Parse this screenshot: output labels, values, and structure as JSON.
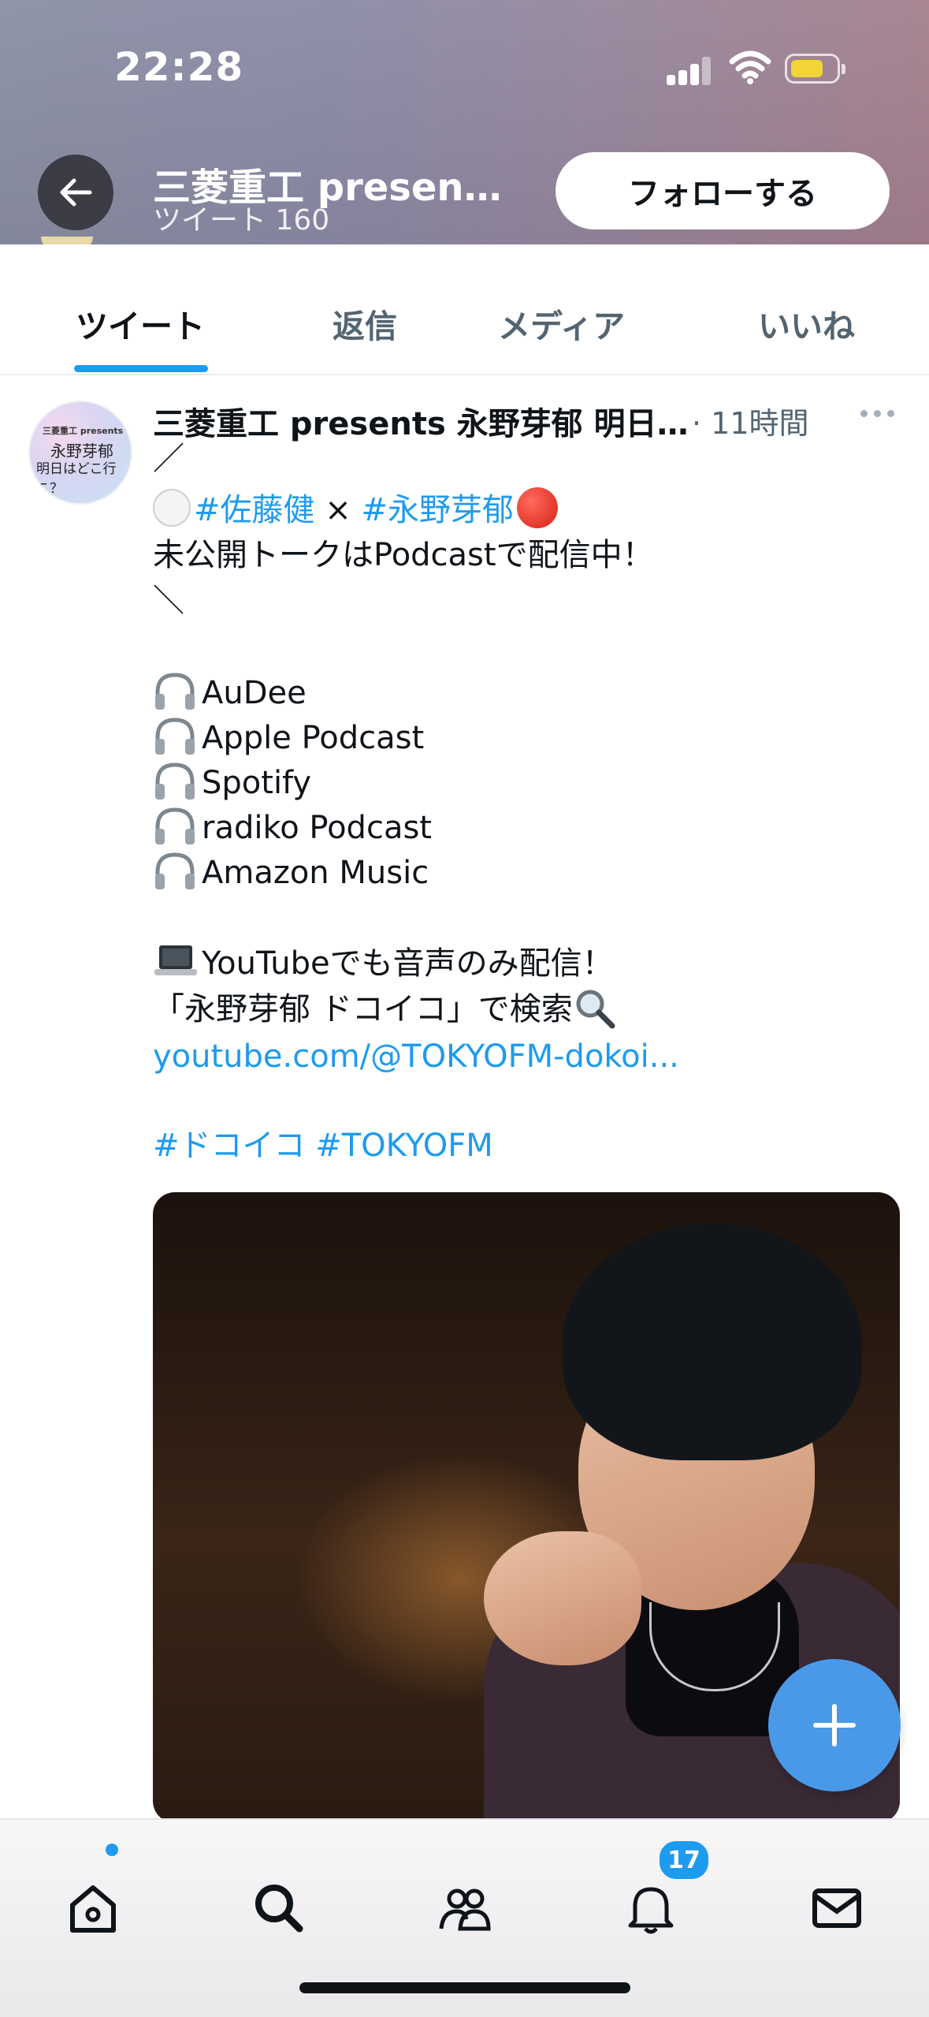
{
  "status_bar": {
    "time": "22:28"
  },
  "header": {
    "account_name": "三菱重工 present...",
    "tweet_count_label": "ツイート 160",
    "follow_label": "フォローする"
  },
  "tabs": [
    {
      "label": "ツイート",
      "active": true
    },
    {
      "label": "返信",
      "active": false
    },
    {
      "label": "メディア",
      "active": false
    },
    {
      "label": "いいね",
      "active": false
    }
  ],
  "tweet": {
    "avatar_lines": [
      "三菱重工 presents",
      "永野芽郁",
      "明日はどこ行こ？"
    ],
    "author": "三菱重工 presents 永野芽郁 明日...",
    "time": "· 11時間",
    "line_slash_open": "／",
    "hashtag_sato": "#佐藤健",
    "times_sign": "×",
    "hashtag_nagano": "#永野芽郁",
    "line_unreleased": "未公開トークはPodcastで配信中！",
    "line_slash_close": "＼",
    "platforms": [
      "AuDee",
      "Apple Podcast",
      "Spotify",
      "radiko Podcast",
      "Amazon Music"
    ],
    "youtube_line": "YouTubeでも音声のみ配信！",
    "search_line": "「永野芽郁 ドコイコ」で検索",
    "link": "youtube.com/@TOKYOFM-dokoi...",
    "hashtags_footer": "#ドコイコ #TOKYOFM"
  },
  "bottom_nav": {
    "items": [
      "home-icon",
      "search-icon",
      "communities-icon",
      "notifications-icon",
      "messages-icon"
    ],
    "notification_badge": "17"
  },
  "colors": {
    "accent": "#1d9bf0",
    "fab": "#4a99e9"
  }
}
